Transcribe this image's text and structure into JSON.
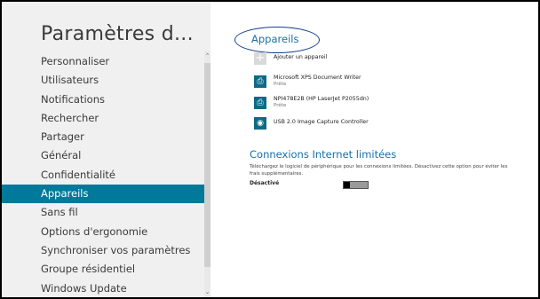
{
  "sidebar": {
    "title": "Paramètres d...",
    "items": [
      {
        "label": "Personnaliser",
        "active": false
      },
      {
        "label": "Utilisateurs",
        "active": false
      },
      {
        "label": "Notifications",
        "active": false
      },
      {
        "label": "Rechercher",
        "active": false
      },
      {
        "label": "Partager",
        "active": false
      },
      {
        "label": "Général",
        "active": false
      },
      {
        "label": "Confidentialité",
        "active": false
      },
      {
        "label": "Appareils",
        "active": true
      },
      {
        "label": "Sans fil",
        "active": false
      },
      {
        "label": "Options d'ergonomie",
        "active": false
      },
      {
        "label": "Synchroniser vos paramètres",
        "active": false
      },
      {
        "label": "Groupe résidentiel",
        "active": false
      },
      {
        "label": "Windows Update",
        "active": false
      }
    ]
  },
  "main": {
    "title": "Appareils",
    "add_device": {
      "label": "Ajouter un appareil"
    },
    "devices": [
      {
        "name": "Microsoft XPS Document Writer",
        "status": "Prête",
        "icon": "printer-icon"
      },
      {
        "name": "NPI478E2B (HP LaserJet P2055dn)",
        "status": "Prête",
        "icon": "printer-icon"
      },
      {
        "name": "USB 2.0 Image Capture Controller",
        "status": "",
        "icon": "webcam-icon"
      }
    ],
    "metered": {
      "title": "Connexions Internet limitées",
      "description": "Téléchargez le logiciel de périphérique pour les connexions limitées. Désactivez cette option pour éviter les frais supplémentaires.",
      "toggle_label": "Désactivé",
      "toggle_on": false
    }
  },
  "colors": {
    "accent": "#00799a",
    "link_blue": "#1a6ea8",
    "annotation_ellipse": "#163d8f"
  }
}
